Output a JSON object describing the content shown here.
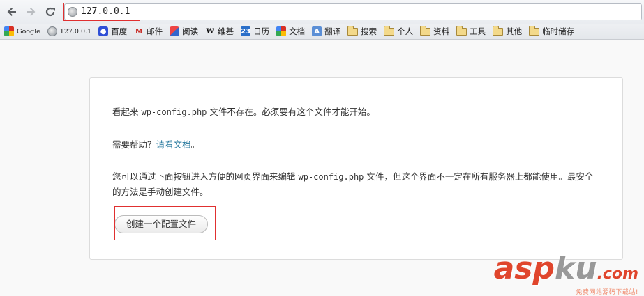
{
  "toolbar": {
    "back_icon": "arrow-left",
    "forward_icon": "arrow-right",
    "reload_icon": "reload",
    "url": "127.0.0.1"
  },
  "bookmarks": [
    {
      "label": "Google",
      "icon": "google-icon"
    },
    {
      "label": "127.0.0.1",
      "icon": "globe-icon"
    },
    {
      "label": "百度",
      "icon": "paw-icon"
    },
    {
      "label": "邮件",
      "icon": "gmail-icon"
    },
    {
      "label": "阅读",
      "icon": "reader-icon"
    },
    {
      "label": "维基",
      "icon": "wikipedia-icon"
    },
    {
      "label": "日历",
      "icon": "calendar-icon",
      "glyph": "23"
    },
    {
      "label": "文档",
      "icon": "docs-icon"
    },
    {
      "label": "翻译",
      "icon": "translate-icon"
    },
    {
      "label": "搜索",
      "icon": "folder-icon"
    },
    {
      "label": "个人",
      "icon": "folder-icon"
    },
    {
      "label": "资料",
      "icon": "folder-icon"
    },
    {
      "label": "工具",
      "icon": "folder-icon"
    },
    {
      "label": "其他",
      "icon": "folder-icon"
    },
    {
      "label": "临时储存",
      "icon": "folder-icon"
    }
  ],
  "content": {
    "p1_before": "看起来 ",
    "p1_code": "wp-config.php",
    "p1_after": " 文件不存在。必须要有这个文件才能开始。",
    "p2_text": "需要帮助？",
    "p2_link": "请看文档",
    "p2_end": "。",
    "p3_before": "您可以通过下面按钮进入方便的网页界面来编辑 ",
    "p3_code": "wp-config.php",
    "p3_after": " 文件，但这个界面不一定在所有服务器上都能使用。最安全的方法是手动创建文件。",
    "button_label": "创建一个配置文件"
  },
  "watermark": {
    "main_a": "asp",
    "main_b": "ku",
    "main_c": ".com",
    "sub": "免费网站源码下载站!"
  },
  "colors": {
    "link": "#21759b",
    "highlight_box": "#e03030",
    "watermark": "#e0452c"
  }
}
